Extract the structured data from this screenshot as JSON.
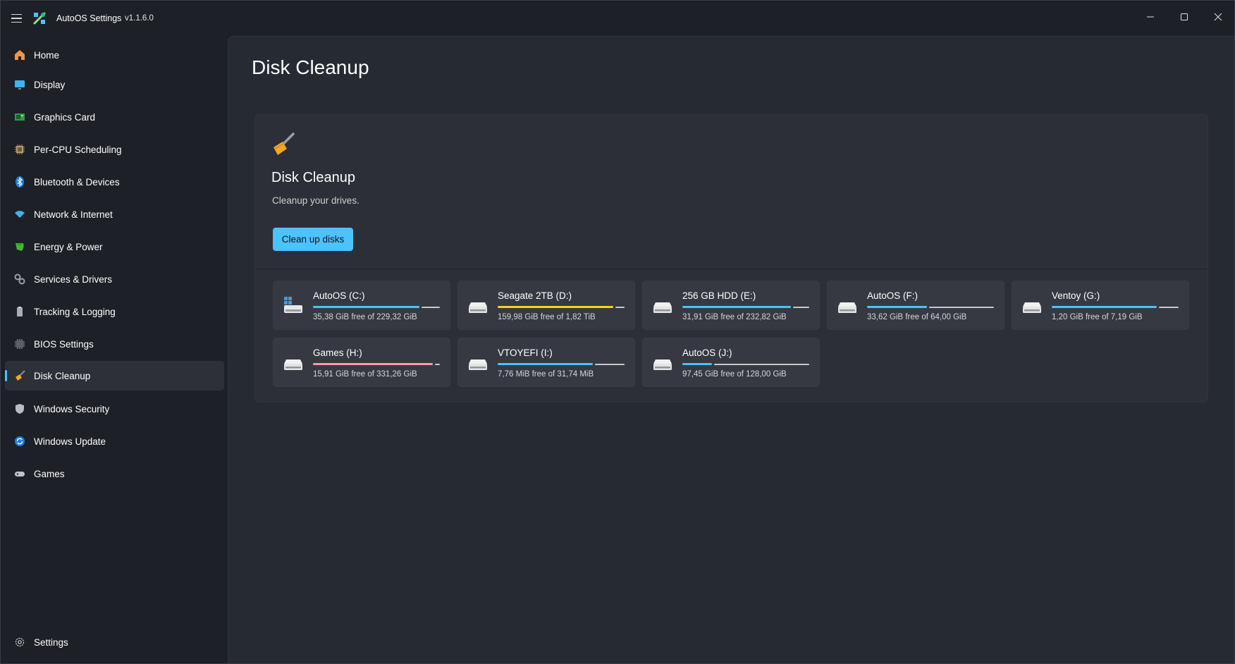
{
  "window": {
    "app_title": "AutoOS Settings",
    "version": "v1.1.6.0"
  },
  "sidebar": {
    "items": [
      {
        "label": "Home",
        "icon": "home-icon"
      },
      {
        "label": "Display",
        "icon": "display-icon"
      },
      {
        "label": "Graphics Card",
        "icon": "graphics-card-icon"
      },
      {
        "label": "Per-CPU Scheduling",
        "icon": "cpu-icon"
      },
      {
        "label": "Bluetooth & Devices",
        "icon": "bluetooth-icon"
      },
      {
        "label": "Network & Internet",
        "icon": "wifi-icon"
      },
      {
        "label": "Energy & Power",
        "icon": "battery-icon"
      },
      {
        "label": "Services & Drivers",
        "icon": "gears-icon"
      },
      {
        "label": "Tracking & Logging",
        "icon": "clipboard-icon"
      },
      {
        "label": "BIOS Settings",
        "icon": "chip-icon"
      },
      {
        "label": "Disk Cleanup",
        "icon": "broom-icon",
        "active": true
      },
      {
        "label": "Windows Security",
        "icon": "shield-icon"
      },
      {
        "label": "Windows Update",
        "icon": "update-icon"
      },
      {
        "label": "Games",
        "icon": "gamepad-icon"
      }
    ],
    "footer": {
      "label": "Settings",
      "icon": "gear-icon"
    }
  },
  "main": {
    "page_title": "Disk Cleanup",
    "card": {
      "title": "Disk Cleanup",
      "description": "Cleanup your drives.",
      "button_label": "Clean up disks"
    },
    "drives": [
      {
        "name": "AutoOS (C:)",
        "free_text": "35,38 GiB free of 229,32 GiB",
        "used_fraction": 0.846,
        "bar_color": "#4cc2ff",
        "system": true
      },
      {
        "name": "Seagate 2TB (D:)",
        "free_text": "159,98 GiB free of 1,82 TiB",
        "used_fraction": 0.914,
        "bar_color": "#f5d21a",
        "system": false
      },
      {
        "name": "256 GB HDD (E:)",
        "free_text": "31,91 GiB free of 232,82 GiB",
        "used_fraction": 0.863,
        "bar_color": "#4cc2ff",
        "system": false
      },
      {
        "name": "AutoOS (F:)",
        "free_text": "33,62 GiB free of 64,00 GiB",
        "used_fraction": 0.475,
        "bar_color": "#4cc2ff",
        "system": false
      },
      {
        "name": "Ventoy (G:)",
        "free_text": "1,20 GiB free of 7,19 GiB",
        "used_fraction": 0.833,
        "bar_color": "#4cc2ff",
        "system": false
      },
      {
        "name": "Games (H:)",
        "free_text": "15,91 GiB free of 331,26 GiB",
        "used_fraction": 0.952,
        "bar_color": "#ff99a4",
        "system": false
      },
      {
        "name": "VTOYEFI (I:)",
        "free_text": "7,76 MiB free of 31,74 MiB",
        "used_fraction": 0.756,
        "bar_color": "#4cc2ff",
        "system": false
      },
      {
        "name": "AutoOS (J:)",
        "free_text": "97,45 GiB free of 128,00 GiB",
        "used_fraction": 0.239,
        "bar_color": "#4cc2ff",
        "system": false
      }
    ]
  },
  "colors": {
    "accent": "#4cc2ff",
    "background": "#1e2027",
    "content": "#262a33"
  }
}
